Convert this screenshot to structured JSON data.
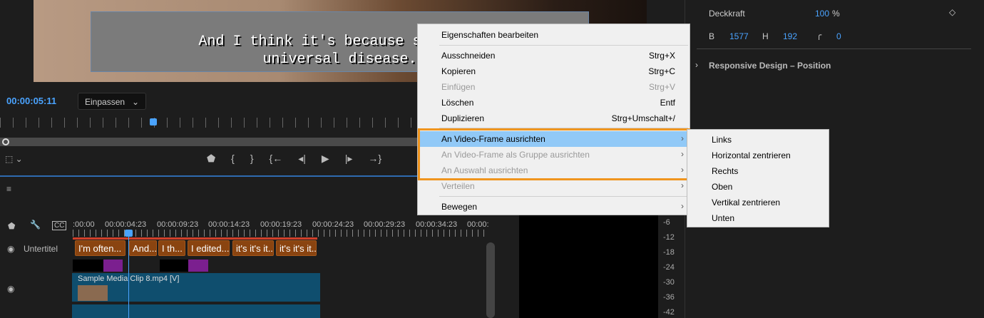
{
  "preview": {
    "subtitle_line1": "And I think it's because spiritua",
    "subtitle_line2": "universal disease.",
    "timecode": "00:00:05:11",
    "fit_label": "Einpassen"
  },
  "timeline": {
    "ticks": [
      ":00:00",
      "00:00:04:23",
      "00:00:09:23",
      "00:00:14:23",
      "00:00:19:23",
      "00:00:24:23",
      "00:00:29:23",
      "00:00:34:23",
      "00:00:"
    ],
    "track_label": "Untertitel",
    "captions": [
      "I'm often...",
      "And...",
      "I th...",
      "I edited...",
      "it's it's it...",
      "it's it's it..."
    ],
    "video_clip": "Sample Media Clip 8.mp4 [V]"
  },
  "meter": {
    "labels": [
      "-6",
      "-12",
      "-18",
      "-24",
      "-30",
      "-36",
      "-42"
    ]
  },
  "properties": {
    "opacity_label": "Deckkraft",
    "opacity_value": "100",
    "opacity_unit": "%",
    "w_label": "B",
    "w_value": "1577",
    "h_label": "H",
    "h_value": "192",
    "radius_value": "0",
    "section": "Responsive Design – Position"
  },
  "menu": {
    "items": [
      {
        "label": "Eigenschaften bearbeiten"
      },
      {
        "label": "Ausschneiden",
        "shortcut": "Strg+X"
      },
      {
        "label": "Kopieren",
        "shortcut": "Strg+C"
      },
      {
        "label": "Einfügen",
        "shortcut": "Strg+V"
      },
      {
        "label": "Löschen",
        "shortcut": "Entf"
      },
      {
        "label": "Duplizieren",
        "shortcut": "Strg+Umschalt+/"
      },
      {
        "label": "An Video-Frame ausrichten"
      },
      {
        "label": "An Video-Frame als Gruppe ausrichten"
      },
      {
        "label": "An Auswahl ausrichten"
      },
      {
        "label": "Verteilen"
      },
      {
        "label": "Bewegen"
      }
    ]
  },
  "submenu": {
    "items": [
      "Links",
      "Horizontal zentrieren",
      "Rechts",
      "Oben",
      "Vertikal zentrieren",
      "Unten"
    ]
  },
  "colors": {
    "accent": "#4aa3ff",
    "highlight": "#91c9f7",
    "callout": "#f0951e"
  }
}
